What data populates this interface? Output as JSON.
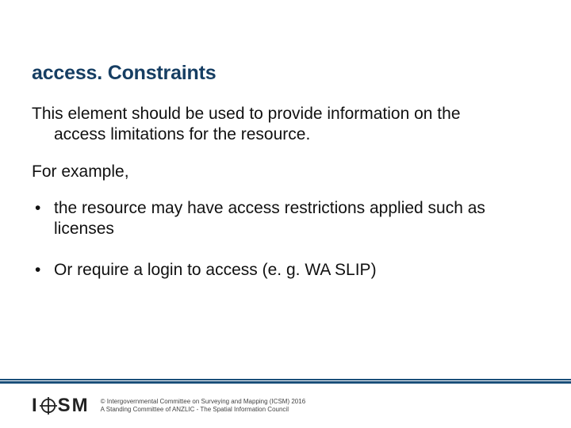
{
  "slide": {
    "title": "access. Constraints",
    "intro_line1": "This element should be used to provide information on the",
    "intro_line2": "access limitations for the resource.",
    "example_label": "For example,",
    "bullets": [
      "the resource may have access restrictions applied such as licenses",
      "Or require a login to access (e. g. WA SLIP)"
    ]
  },
  "footer": {
    "logo_i": "I",
    "logo_sm": "SM",
    "caption_line1": "© Intergovernmental Committee on Surveying and Mapping (ICSM) 2016",
    "caption_line2": "A Standing Committee of ANZLIC - The Spatial Information Council"
  },
  "colors": {
    "title": "#163e63",
    "rule": "#1b4f7a"
  }
}
